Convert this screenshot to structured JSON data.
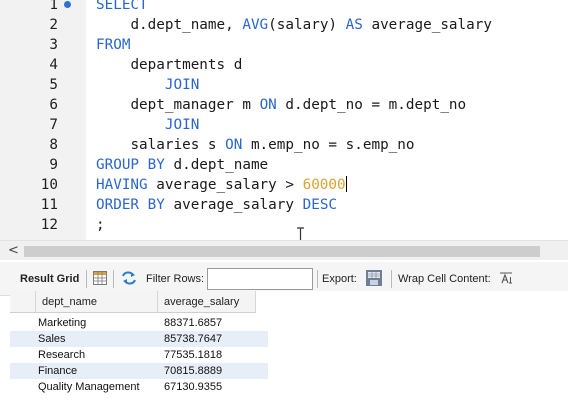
{
  "editor": {
    "lines": [
      {
        "n": "1",
        "marker": true,
        "indent": "",
        "tokens": [
          {
            "t": "SELECT",
            "c": "kw"
          }
        ]
      },
      {
        "n": "2",
        "indent": "    ",
        "tokens": [
          {
            "t": "d.dept_name, ",
            "c": "id"
          },
          {
            "t": "AVG",
            "c": "kw"
          },
          {
            "t": "(salary) ",
            "c": "id"
          },
          {
            "t": "AS",
            "c": "kw"
          },
          {
            "t": " average_salary",
            "c": "id"
          }
        ]
      },
      {
        "n": "3",
        "indent": "",
        "tokens": [
          {
            "t": "FROM",
            "c": "kw"
          }
        ]
      },
      {
        "n": "4",
        "indent": "    ",
        "tokens": [
          {
            "t": "departments d",
            "c": "id"
          }
        ]
      },
      {
        "n": "5",
        "indent": "        ",
        "tokens": [
          {
            "t": "JOIN",
            "c": "kw"
          }
        ]
      },
      {
        "n": "6",
        "indent": "    ",
        "tokens": [
          {
            "t": "dept_manager m ",
            "c": "id"
          },
          {
            "t": "ON",
            "c": "kw"
          },
          {
            "t": " d.dept_no = m.dept_no",
            "c": "id"
          }
        ]
      },
      {
        "n": "7",
        "indent": "        ",
        "tokens": [
          {
            "t": "JOIN",
            "c": "kw"
          }
        ]
      },
      {
        "n": "8",
        "indent": "    ",
        "tokens": [
          {
            "t": "salaries s ",
            "c": "id"
          },
          {
            "t": "ON",
            "c": "kw"
          },
          {
            "t": " m.emp_no = s.emp_no",
            "c": "id"
          }
        ]
      },
      {
        "n": "9",
        "indent": "",
        "tokens": [
          {
            "t": "GROUP BY",
            "c": "kw"
          },
          {
            "t": " d.dept_name",
            "c": "id"
          }
        ]
      },
      {
        "n": "10",
        "indent": "",
        "caret": true,
        "tokens": [
          {
            "t": "HAVING",
            "c": "kw"
          },
          {
            "t": " average_salary > ",
            "c": "id"
          },
          {
            "t": "60000",
            "c": "num"
          }
        ]
      },
      {
        "n": "11",
        "indent": "",
        "tokens": [
          {
            "t": "ORDER BY",
            "c": "kw"
          },
          {
            "t": " average_salary ",
            "c": "id"
          },
          {
            "t": "DESC",
            "c": "kw"
          }
        ]
      },
      {
        "n": "12",
        "indent": "",
        "tokens": [
          {
            "t": ";",
            "c": "id"
          }
        ]
      }
    ],
    "colors": {
      "keyword": "#2b66c9",
      "number": "#d8a235",
      "text": "#1a1a1a",
      "gutter": "#f2f2f2"
    }
  },
  "scrollbar": {
    "left_arrow": "<"
  },
  "toolbar": {
    "result_grid_label": "Result Grid",
    "filter_rows_label": "Filter Rows:",
    "filter_rows_value": "",
    "export_label": "Export:",
    "wrap_cell_label": "Wrap Cell Content:",
    "icons": [
      "grid-icon",
      "refresh-icon",
      "export-icon",
      "wrap-cell-icon"
    ]
  },
  "grid": {
    "columns": [
      "dept_name",
      "average_salary"
    ],
    "rows": [
      [
        "Marketing",
        "88371.6857"
      ],
      [
        "Sales",
        "85738.7647"
      ],
      [
        "Research",
        "77535.1818"
      ],
      [
        "Finance",
        "70815.8889"
      ],
      [
        "Quality Management",
        "67130.9355"
      ]
    ],
    "alt_row_color": "#e8eef8"
  }
}
